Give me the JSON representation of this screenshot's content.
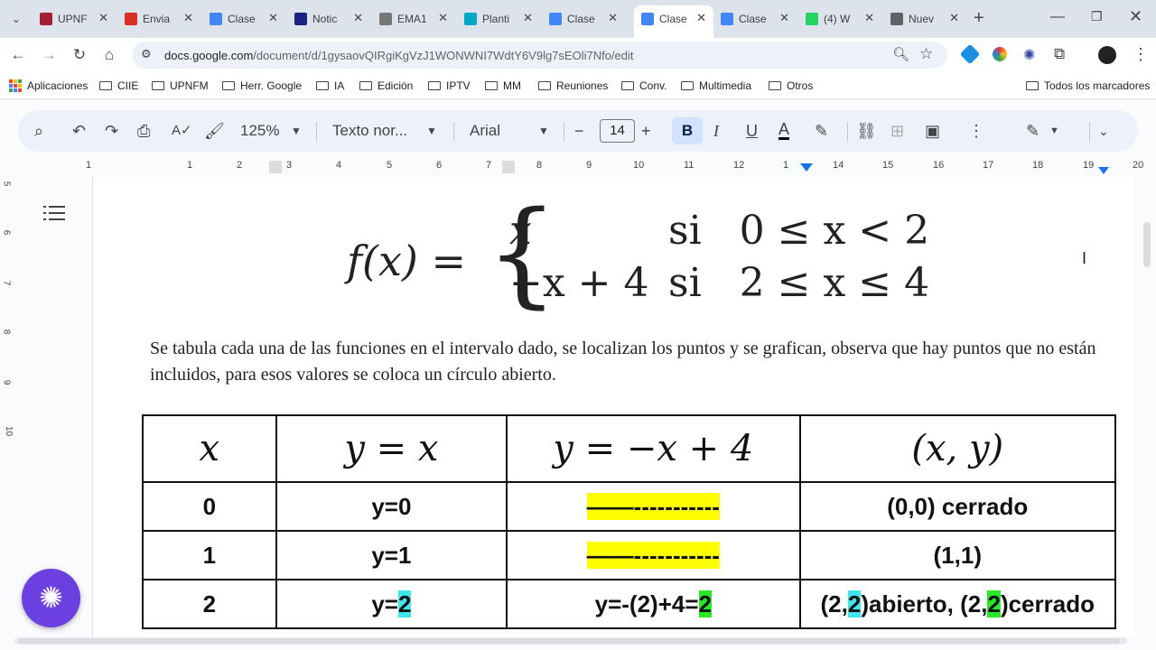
{
  "browser": {
    "tabs": [
      {
        "label": "UPNF",
        "icon": "upnfm-favicon-icon",
        "color": "#a31f34"
      },
      {
        "label": "Envia",
        "icon": "gmail-favicon-icon",
        "color": "#d93025"
      },
      {
        "label": "Clase",
        "icon": "docs-favicon-icon",
        "color": "#4285f4"
      },
      {
        "label": "Notic",
        "icon": "news-favicon-icon",
        "color": "#1a237e"
      },
      {
        "label": "EMA1",
        "icon": "record-favicon-icon",
        "color": "#777777"
      },
      {
        "label": "Planti",
        "icon": "canva-favicon-icon",
        "color": "#00a8c8"
      },
      {
        "label": "Clase",
        "icon": "docs-favicon-icon",
        "color": "#4285f4"
      },
      {
        "label": "Clase",
        "icon": "docs-favicon-icon",
        "color": "#4285f4",
        "active": true
      },
      {
        "label": "Clase",
        "icon": "docs-favicon-icon",
        "color": "#4285f4"
      },
      {
        "label": "(4) W",
        "icon": "whatsapp-favicon-icon",
        "color": "#25d366"
      },
      {
        "label": "Nuev",
        "icon": "chrome-favicon-icon",
        "color": "#5f6368"
      }
    ],
    "url_host": "docs.google.com",
    "url_path": "/document/d/1gysaovQIRgiKgVzJ1WONWNI7WdtY6V9lg7sEOli7Nfo/edit",
    "bookmarks": [
      "Aplicaciones",
      "CIIE",
      "UPNFM",
      "Herr. Google",
      "IA",
      "Edición",
      "IPTV",
      "MM",
      "Reuniones",
      "Conv.",
      "Multimedia",
      "Otros"
    ],
    "all_bookmarks": "Todos los marcadores"
  },
  "toolbar": {
    "zoom": "125%",
    "style": "Texto nor...",
    "font": "Arial",
    "font_size": "14",
    "bold": "B",
    "italic": "I",
    "underline": "U",
    "text_color": "A"
  },
  "ruler": {
    "numbers": [
      "1",
      "1",
      "2",
      "3",
      "4",
      "5",
      "6",
      "7",
      "8",
      "9",
      "10",
      "11",
      "12",
      "1",
      "14",
      "15",
      "16",
      "17",
      "18",
      "19",
      "20"
    ],
    "vertical": [
      "5",
      "6",
      "7",
      "8",
      "9",
      "10"
    ]
  },
  "document": {
    "formula": {
      "lhs": "f(x) =",
      "case1_expr": "x",
      "case1_cond": "si   0 ≤ x < 2",
      "case2_expr": "−x + 4",
      "case2_cond": "si   2 ≤ x ≤ 4"
    },
    "paragraph": "Se tabula cada una de las funciones en el intervalo dado, se localizan los puntos y se grafican, observa que hay puntos que no están incluidos, para esos valores se coloca un círculo abierto.",
    "table": {
      "headers": [
        "x",
        "y = x",
        "y = −x + 4",
        "(x, y)"
      ],
      "rows": [
        {
          "x": "0",
          "y1": "y=0",
          "y2": "——-----------",
          "pt": "(0,0) cerrado"
        },
        {
          "x": "1",
          "y1": "y=1",
          "y2": "——-----------",
          "pt": "(1,1)"
        },
        {
          "x": "2",
          "y1_pre": "y=",
          "y1_val": "2",
          "y2_pre": "y=-(2)+4=",
          "y2_val": "2",
          "pt_a": "(2,",
          "pt_b": "2",
          "pt_c": ")abierto, (2,",
          "pt_d": "2",
          "pt_e": ")cerrado"
        }
      ]
    }
  },
  "colors": {
    "highlight_yellow": "#ffff00",
    "highlight_cyan": "#3ee7ef",
    "highlight_green": "#29e829",
    "accent": "#6c3fe0"
  }
}
